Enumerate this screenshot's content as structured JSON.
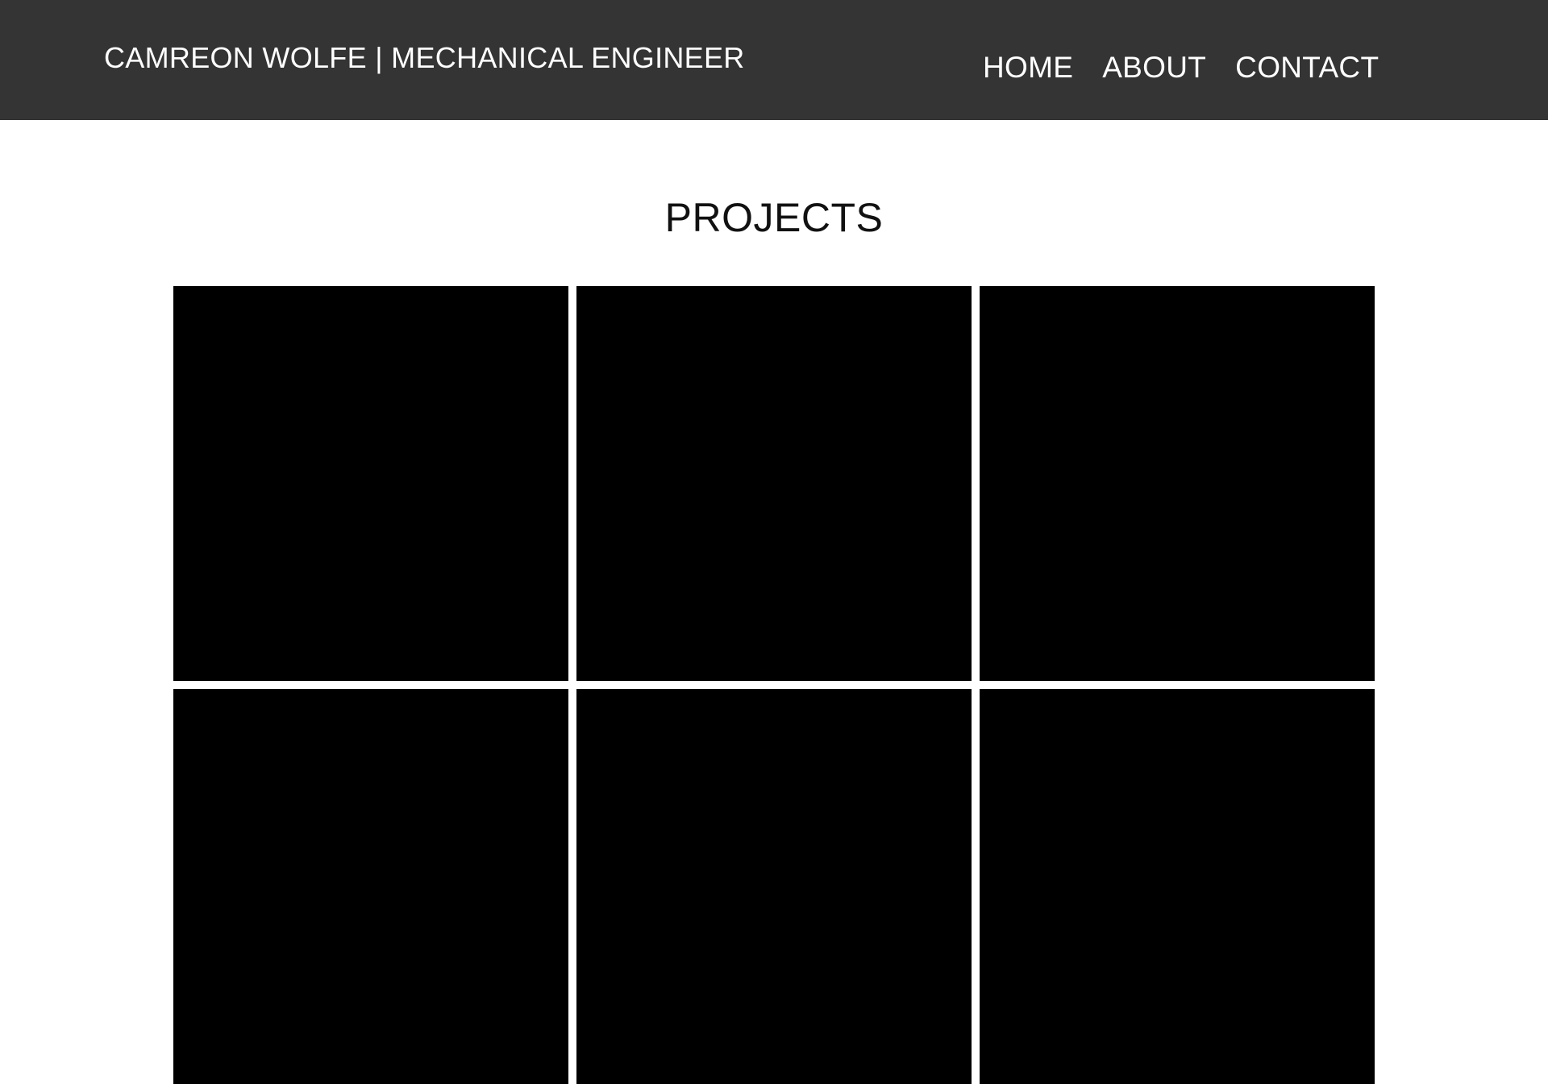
{
  "header": {
    "brand": "CAMREON WOLFE | MECHANICAL ENGINEER",
    "nav": [
      "HOME",
      "ABOUT",
      "CONTACT"
    ]
  },
  "main": {
    "title": "PROJECTS",
    "tile_count": 6
  },
  "colors": {
    "header_bg": "#343434",
    "header_text": "#ffffff",
    "tile": "#000000",
    "page_bg": "#ffffff"
  }
}
